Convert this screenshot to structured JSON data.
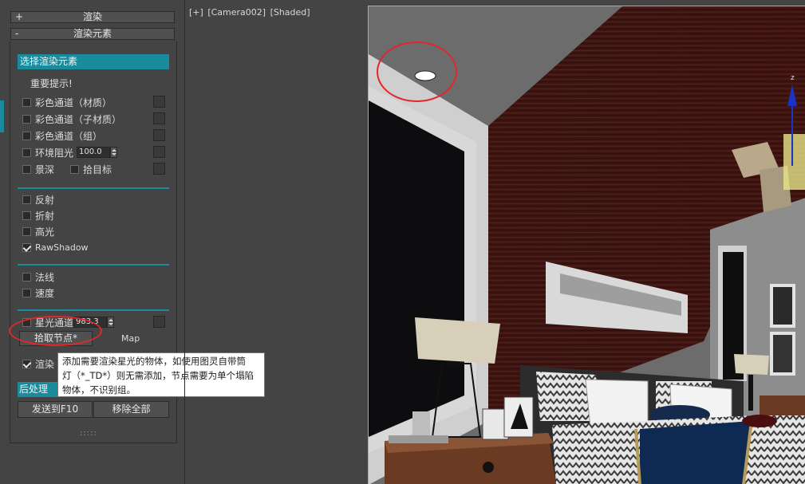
{
  "panel": {
    "render_header": "渲染",
    "elements_header": "渲染元素",
    "select_elements": "选择渲染元素",
    "notice": "重要提示!",
    "channel_options": [
      {
        "label": "彩色通道（材质）",
        "checked": false
      },
      {
        "label": "彩色通道（子材质）",
        "checked": false
      },
      {
        "label": "彩色通道（组）",
        "checked": false
      }
    ],
    "ao": {
      "label": "环境阻光",
      "checked": false,
      "value": "100.0"
    },
    "dof": {
      "label": "景深",
      "checked": false
    },
    "pick_target": {
      "label": "拾目标",
      "checked": false
    },
    "pass_options": [
      {
        "label": "反射",
        "checked": false
      },
      {
        "label": "折射",
        "checked": false
      },
      {
        "label": "高光",
        "checked": false
      },
      {
        "label": "RawShadow",
        "checked": true
      }
    ],
    "vector_options": [
      {
        "label": "法线",
        "checked": false
      },
      {
        "label": "速度",
        "checked": false
      }
    ],
    "starlight": {
      "label": "星光通道",
      "checked": false,
      "value": "983.3"
    },
    "pick_node_button": "拾取节点*",
    "map_label": "Map",
    "render_checkbox": {
      "label": "渲染",
      "checked": true
    },
    "post_process": "后处理",
    "send_button": "发送到F10",
    "clear_button": "移除全部",
    "grip": ":::::"
  },
  "tooltip": {
    "lines": [
      "添加需要渲染星光的物体，如使用图灵自带筒",
      "灯（*_TD*）则无需添加，节点需要为单个塌陷",
      "物体，不识别组。"
    ]
  },
  "viewport": {
    "label_parts": [
      "[+]",
      "[Camera002]",
      "[Shaded]"
    ],
    "axis_label": "z"
  },
  "colors": {
    "accent": "#1a8b9c",
    "annotation": "#e0282a",
    "viewport_border": "#d6b500"
  },
  "icons": {
    "expand": "+",
    "collapse": "-"
  }
}
